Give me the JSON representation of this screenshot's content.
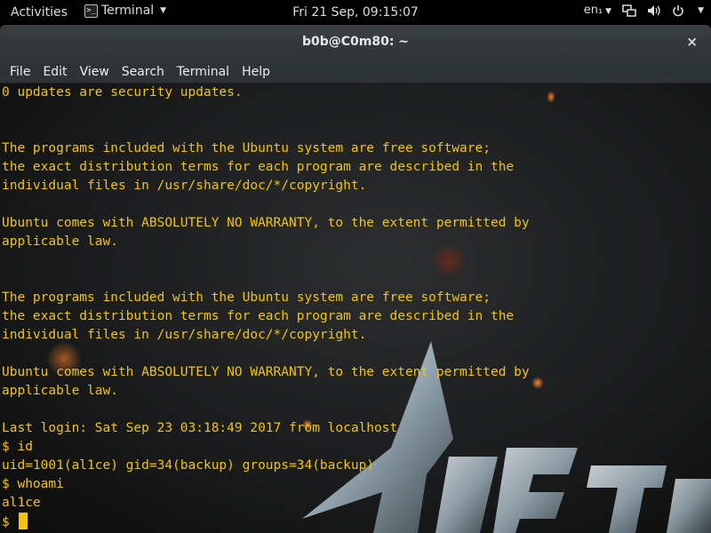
{
  "topbar": {
    "activities": "Activities",
    "app_name": "Terminal",
    "app_icon_glyph": ">_",
    "clock": "Fri 21 Sep, 09:15:07",
    "keyboard_layout": "en₁",
    "icons": [
      "network-icon",
      "volume-icon",
      "power-icon"
    ]
  },
  "window": {
    "title": "b0b@C0m80: ~",
    "close": "×"
  },
  "menu": {
    "file": "File",
    "edit": "Edit",
    "view": "View",
    "search": "Search",
    "terminal": "Terminal",
    "help": "Help"
  },
  "terminal": {
    "text_color": "#f1c40f",
    "lines": [
      "0 updates are security updates.",
      "",
      "",
      "The programs included with the Ubuntu system are free software;",
      "the exact distribution terms for each program are described in the",
      "individual files in /usr/share/doc/*/copyright.",
      "",
      "Ubuntu comes with ABSOLUTELY NO WARRANTY, to the extent permitted by",
      "applicable law.",
      "",
      "",
      "The programs included with the Ubuntu system are free software;",
      "the exact distribution terms for each program are described in the",
      "individual files in /usr/share/doc/*/copyright.",
      "",
      "Ubuntu comes with ABSOLUTELY NO WARRANTY, to the extent permitted by",
      "applicable law.",
      "",
      "Last login: Sat Sep 23 03:18:49 2017 from localhost",
      "$ id",
      "uid=1001(al1ce) gid=34(backup) groups=34(backup)",
      "$ whoami",
      "al1ce"
    ],
    "prompt": "$ "
  }
}
